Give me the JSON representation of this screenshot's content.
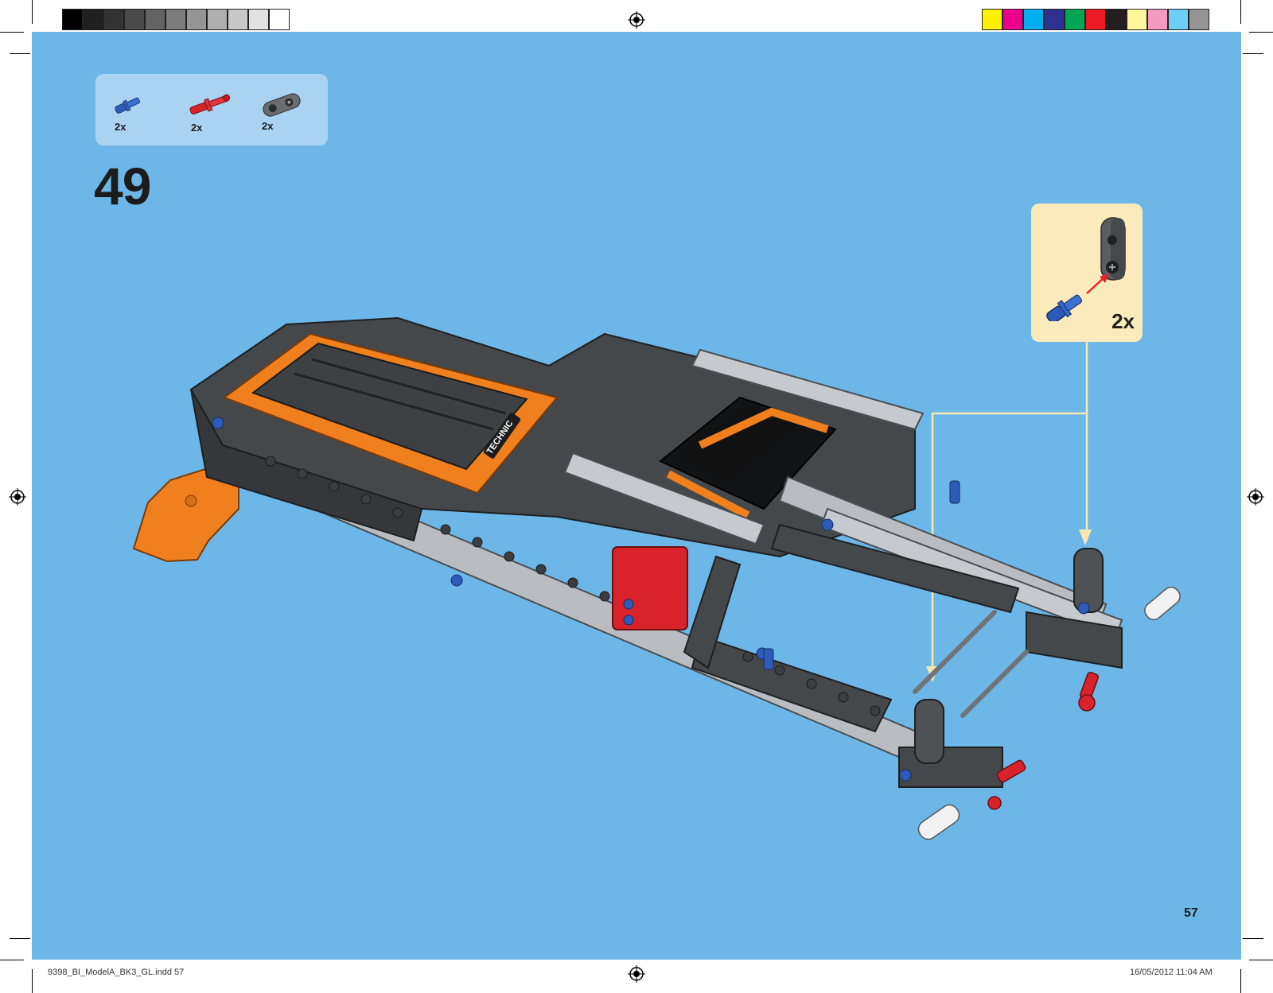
{
  "parts_list": [
    {
      "name": "blue-axle-pin-icon",
      "quantity": "2x",
      "color": "#2d5bb8"
    },
    {
      "name": "red-axle-pin-icon",
      "quantity": "2x",
      "color": "#d8232a"
    },
    {
      "name": "gray-connector-icon",
      "quantity": "2x",
      "color": "#5a5a5a"
    }
  ],
  "step_number": "49",
  "callout": {
    "quantity": "2x"
  },
  "page_number": "57",
  "slug": {
    "file": "9398_BI_ModelA_BK3_GL.indd   57",
    "timestamp": "16/05/2012   11:04 AM"
  },
  "brand_text": "TECHNIC",
  "colors": {
    "page_background": "#6cb7e8",
    "parts_box": "#a9d3f1",
    "callout_box": "#fbebbc",
    "guide_line": "#f6e8b0",
    "technic_orange": "#f07f1e",
    "dark_bluish_gray": "#4a4d50",
    "light_bluish_gray": "#b8bcc0"
  }
}
